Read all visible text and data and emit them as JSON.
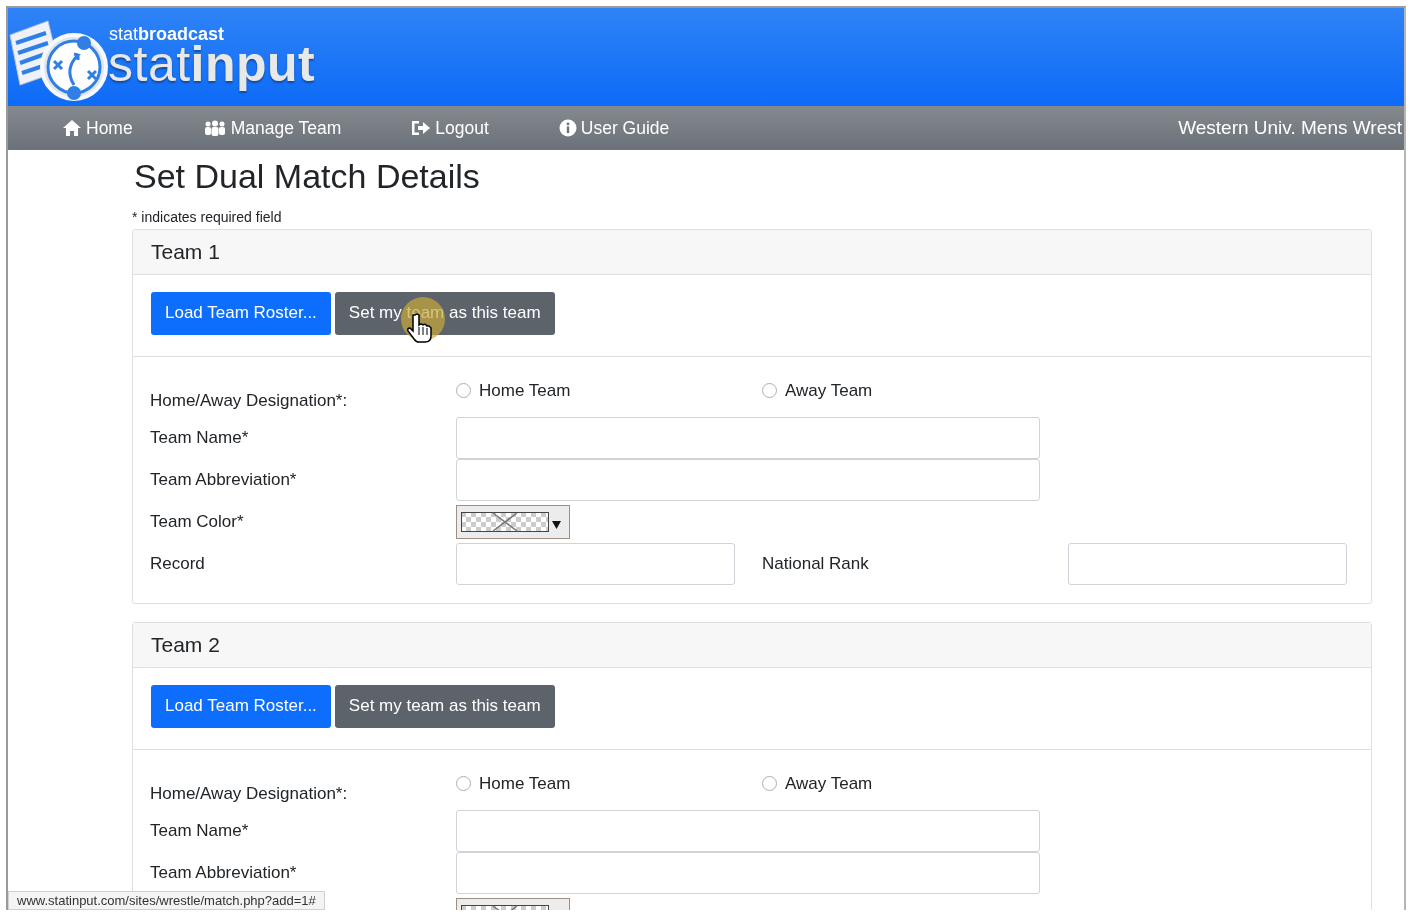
{
  "logo": {
    "brand": "stat**broadcast**",
    "product": "stat**input**"
  },
  "nav": {
    "items": [
      {
        "label": "Home"
      },
      {
        "label": "Manage Team"
      },
      {
        "label": "Logout"
      },
      {
        "label": "User Guide"
      }
    ],
    "team_name": "Western Univ. Mens Wrest"
  },
  "page": {
    "title": "Set Dual Match Details",
    "required_note": "* indicates required field"
  },
  "teams": [
    {
      "title": "Team 1",
      "buttons": [
        {
          "label": "Load Team Roster...",
          "kind": "primary",
          "hovered": false
        },
        {
          "label": "Set my team as this team",
          "kind": "secondary",
          "hovered": true
        }
      ],
      "designation_label": "Home/Away Designation*:",
      "options": [
        {
          "label": "Home Team",
          "selected": false
        },
        {
          "label": "Away Team",
          "selected": false
        }
      ],
      "fields": [
        {
          "label": "Team Name*",
          "kind": "text"
        },
        {
          "label": "Team Abbreviation*",
          "kind": "text"
        },
        {
          "label": "Team Color*",
          "kind": "color"
        },
        {
          "label": "Record",
          "kind": "pair",
          "label_2": "National Rank"
        }
      ]
    },
    {
      "title": "Team 2",
      "buttons": [
        {
          "label": "Load Team Roster...",
          "kind": "primary",
          "hovered": false
        },
        {
          "label": "Set my team as this team",
          "kind": "secondary",
          "hovered": false
        }
      ],
      "designation_label": "Home/Away Designation*:",
      "options": [
        {
          "label": "Home Team",
          "selected": false
        },
        {
          "label": "Away Team",
          "selected": false
        }
      ],
      "fields": [
        {
          "label": "Team Name*",
          "kind": "text"
        },
        {
          "label": "Team Abbreviation*",
          "kind": "text"
        },
        {
          "kind": "color"
        }
      ]
    }
  ],
  "status_bar": {
    "url": "www.statinput.com/sites/wrestle/match.php?add=1#"
  }
}
